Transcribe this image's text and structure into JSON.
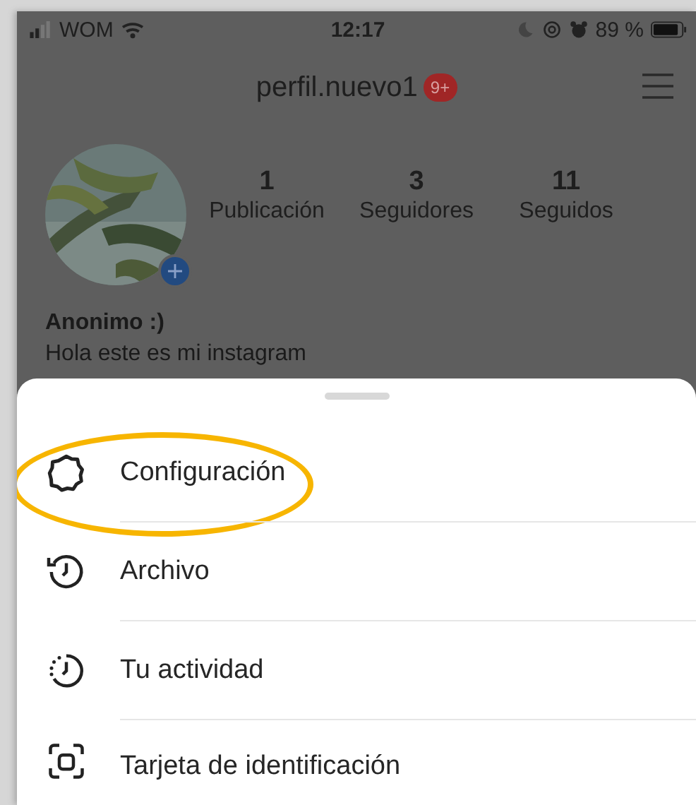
{
  "status_bar": {
    "carrier": "WOM",
    "time": "12:17",
    "battery": "89 %"
  },
  "header": {
    "username": "perfil.nuevo1",
    "badge": "9+"
  },
  "stats": [
    {
      "value": "1",
      "label": "Publicación"
    },
    {
      "value": "3",
      "label": "Seguidores"
    },
    {
      "value": "11",
      "label": "Seguidos"
    }
  ],
  "bio": {
    "name": "Anonimo :)",
    "text": "Hola este es mi instagram"
  },
  "menu": [
    {
      "kind": "gear",
      "label": "Configuración",
      "highlighted": true
    },
    {
      "kind": "archive",
      "label": "Archivo",
      "highlighted": false
    },
    {
      "kind": "activity",
      "label": "Tu actividad",
      "highlighted": false
    },
    {
      "kind": "idcard",
      "label": "Tarjeta de identificación",
      "highlighted": false
    }
  ]
}
